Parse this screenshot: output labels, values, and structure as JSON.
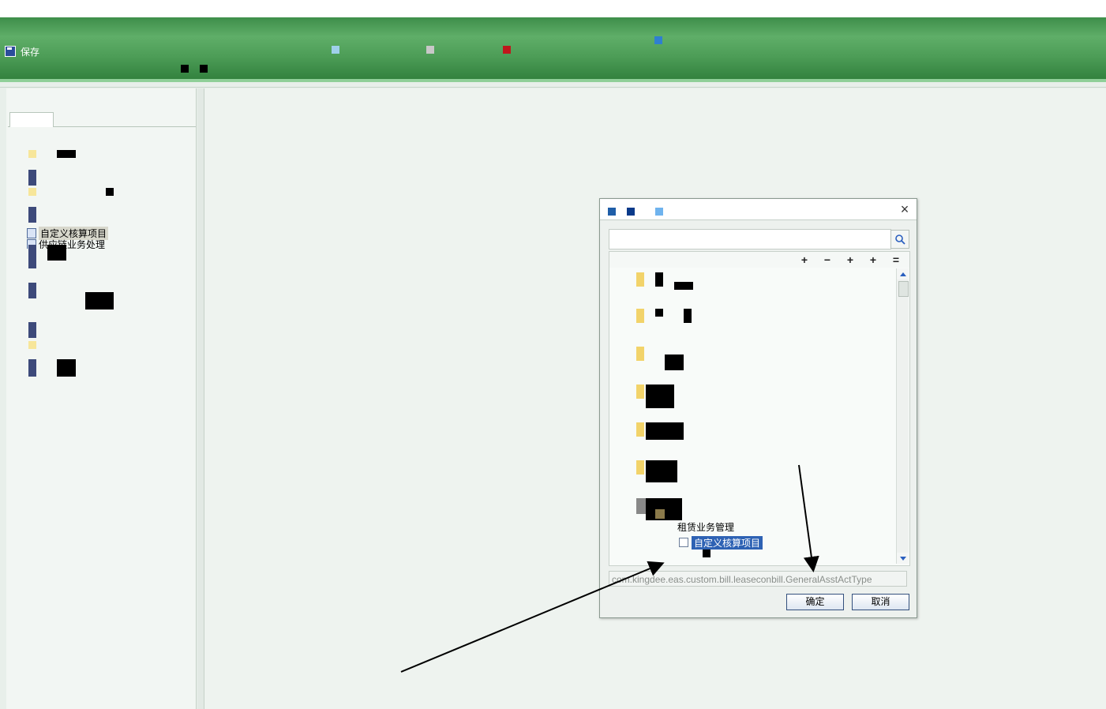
{
  "toolbar": {
    "save_label": "保存"
  },
  "left_tree": {
    "items": [
      {
        "label": "自定义核算项目",
        "selected": true
      },
      {
        "label": "供应链业务处理",
        "selected": false
      }
    ]
  },
  "dialog": {
    "close_glyph": "×",
    "search": {
      "value": "",
      "placeholder": ""
    },
    "tools": [
      "+",
      "−",
      "+",
      "+",
      "="
    ],
    "tree": {
      "parent_label": "租赁业务管理",
      "selected_item": "自定义核算项目"
    },
    "path": "com.kingdee.eas.custom.bill.leaseconbill.GeneralAsstActType",
    "ok_label": "确定",
    "cancel_label": "取消"
  },
  "colors": {
    "green_bar": "#4d9d57",
    "selection": "#2e62b4",
    "background": "#e8efea"
  }
}
